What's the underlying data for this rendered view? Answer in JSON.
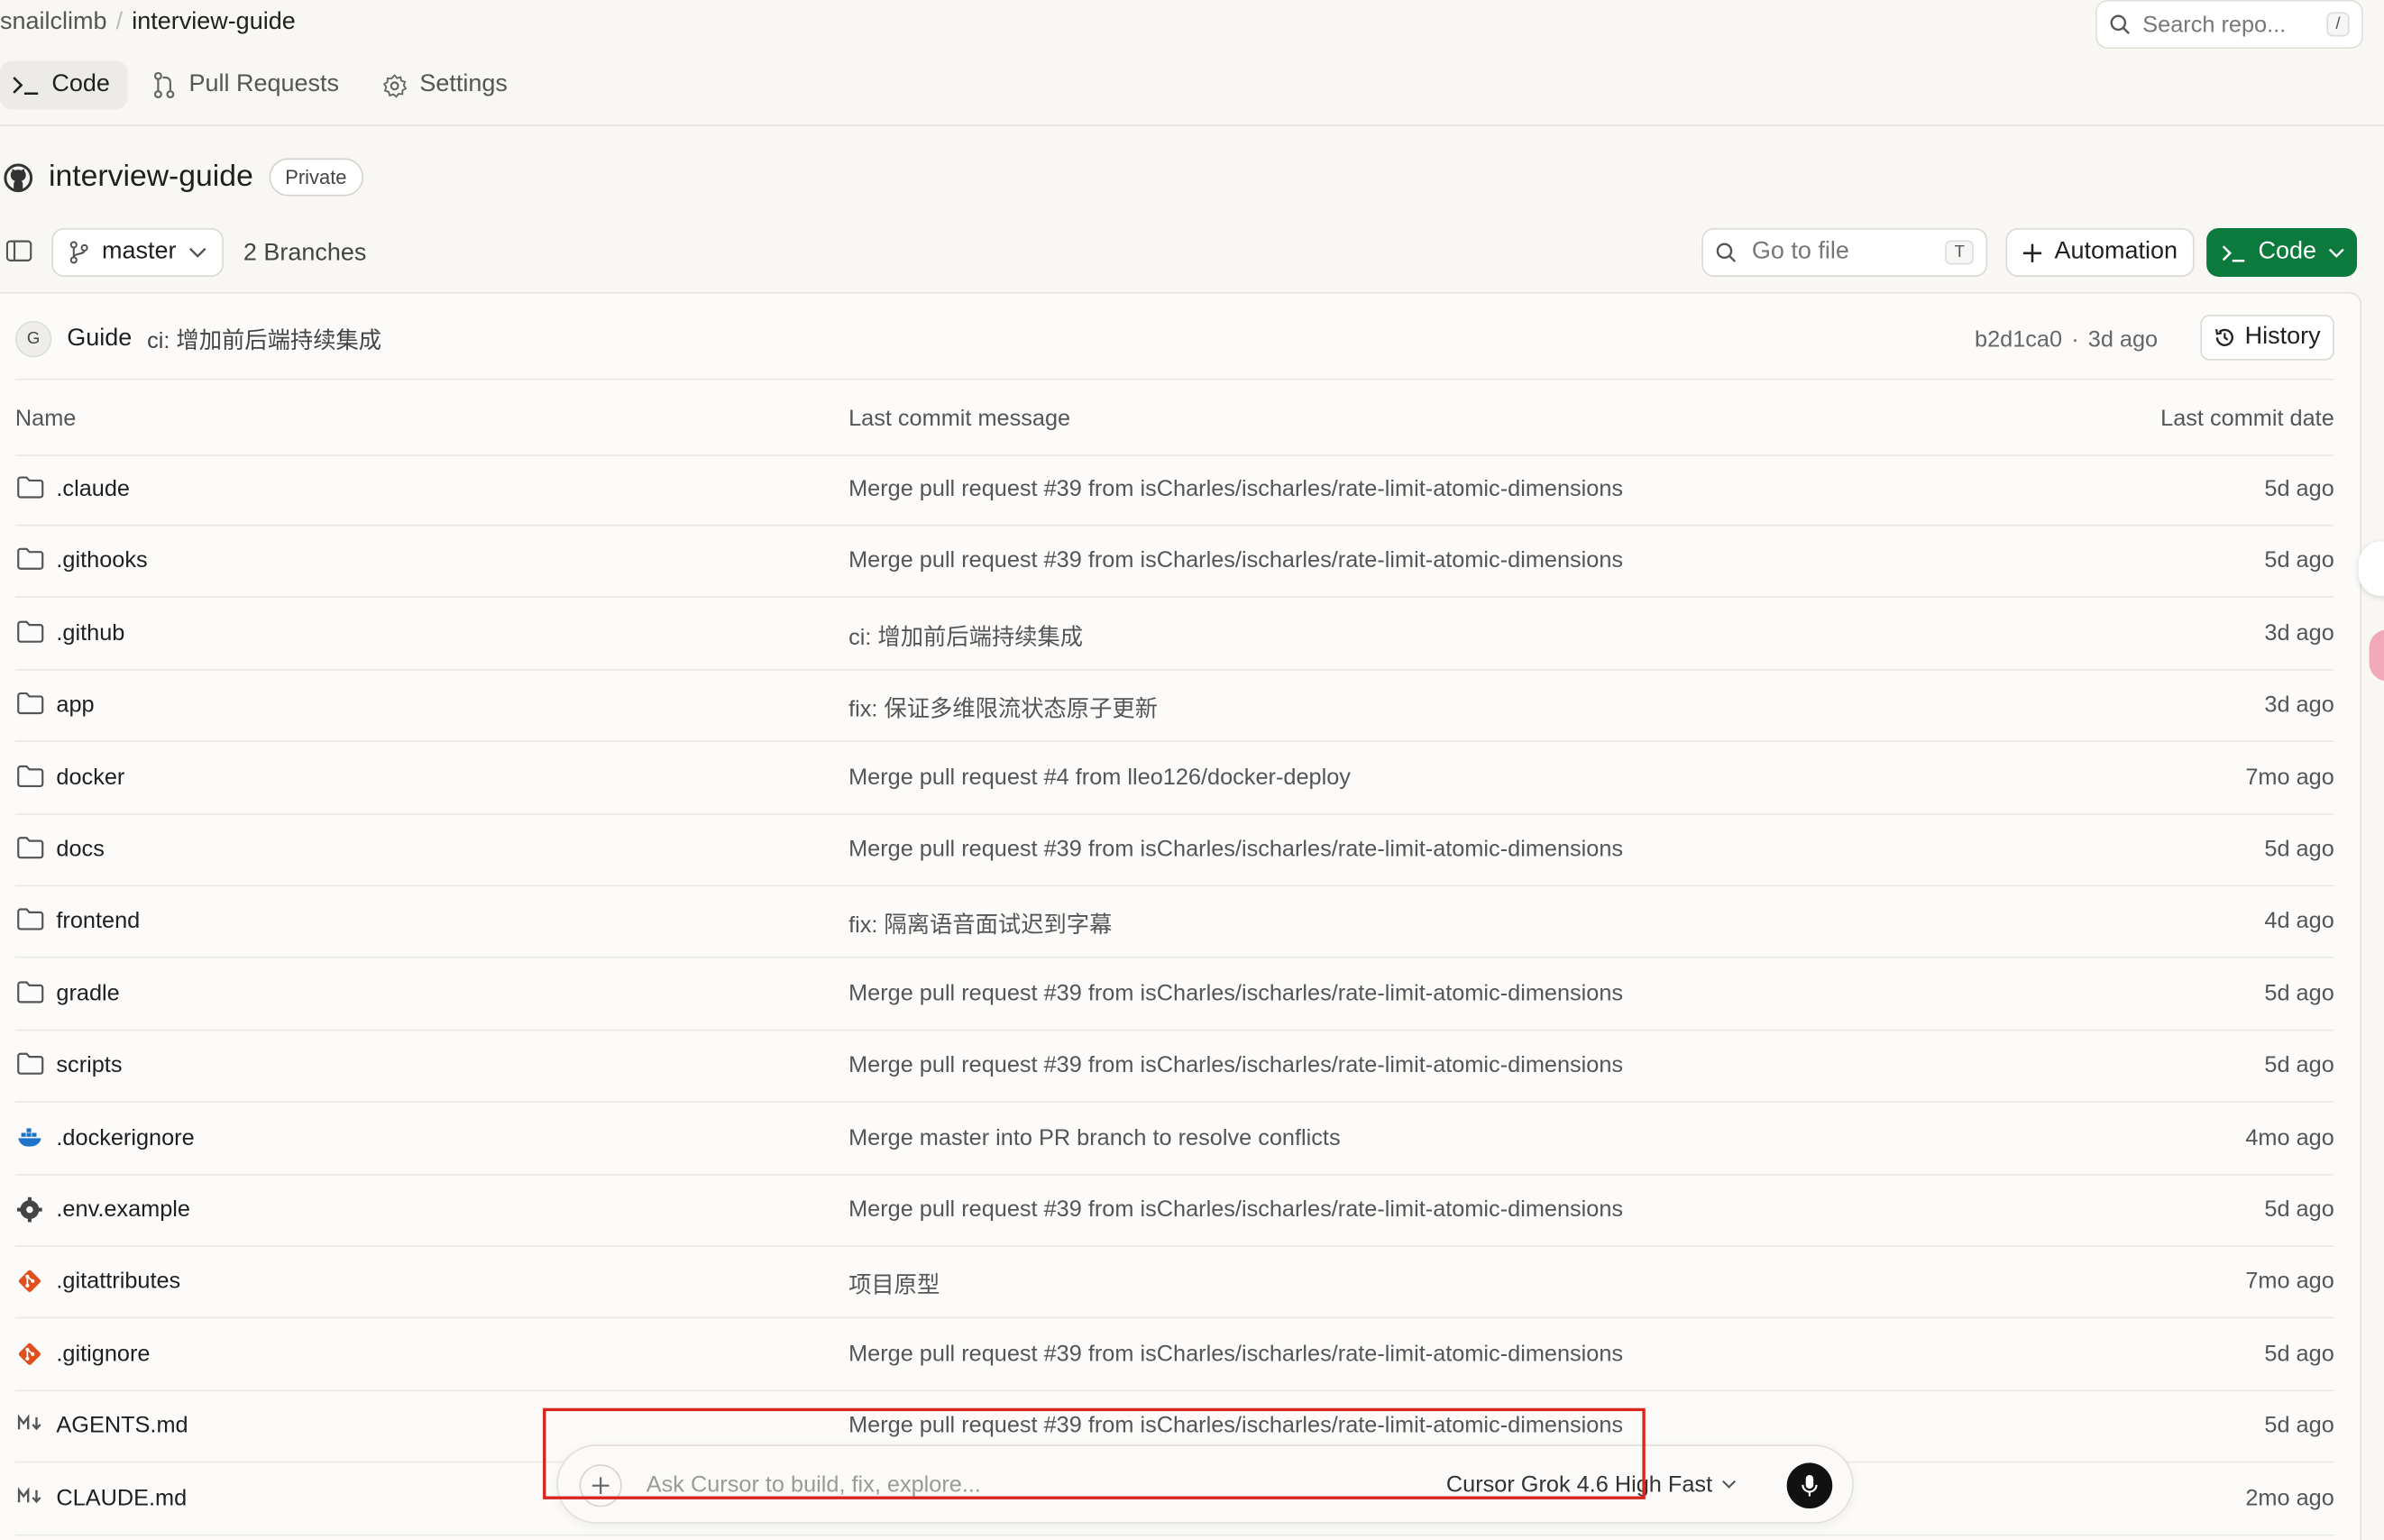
{
  "breadcrumb": {
    "owner": "snailclimb",
    "separator": "/",
    "repo": "interview-guide"
  },
  "search": {
    "placeholder": "Search repo...",
    "shortcut": "/"
  },
  "tabs": [
    {
      "label": "Code",
      "active": true,
      "icon": "terminal-icon"
    },
    {
      "label": "Pull Requests",
      "active": false,
      "icon": "pull-request-icon"
    },
    {
      "label": "Settings",
      "active": false,
      "icon": "gear-icon"
    }
  ],
  "repo": {
    "name": "interview-guide",
    "visibility": "Private"
  },
  "toolbar": {
    "branch": "master",
    "branches_count": "2 Branches",
    "goto_placeholder": "Go to file",
    "goto_shortcut": "T",
    "automation_label": "Automation",
    "code_label": "Code"
  },
  "latest_commit": {
    "avatar_letter": "G",
    "author": "Guide",
    "message": "ci: 增加前后端持续集成",
    "sha": "b2d1ca0",
    "sep": "·",
    "time": "3d ago",
    "history_label": "History"
  },
  "table": {
    "headers": {
      "name": "Name",
      "message": "Last commit message",
      "date": "Last commit date"
    },
    "rows": [
      {
        "name": ".claude",
        "type": "folder",
        "message": "Merge pull request #39 from isCharles/ischarles/rate-limit-atomic-dimensions",
        "date": "5d ago"
      },
      {
        "name": ".githooks",
        "type": "folder",
        "message": "Merge pull request #39 from isCharles/ischarles/rate-limit-atomic-dimensions",
        "date": "5d ago"
      },
      {
        "name": ".github",
        "type": "folder",
        "message": "ci: 增加前后端持续集成",
        "date": "3d ago"
      },
      {
        "name": "app",
        "type": "folder",
        "message": "fix: 保证多维限流状态原子更新",
        "date": "3d ago"
      },
      {
        "name": "docker",
        "type": "folder",
        "message": "Merge pull request #4 from lleo126/docker-deploy",
        "date": "7mo ago"
      },
      {
        "name": "docs",
        "type": "folder",
        "message": "Merge pull request #39 from isCharles/ischarles/rate-limit-atomic-dimensions",
        "date": "5d ago"
      },
      {
        "name": "frontend",
        "type": "folder",
        "message": "fix: 隔离语音面试迟到字幕",
        "date": "4d ago"
      },
      {
        "name": "gradle",
        "type": "folder",
        "message": "Merge pull request #39 from isCharles/ischarles/rate-limit-atomic-dimensions",
        "date": "5d ago"
      },
      {
        "name": "scripts",
        "type": "folder",
        "message": "Merge pull request #39 from isCharles/ischarles/rate-limit-atomic-dimensions",
        "date": "5d ago"
      },
      {
        "name": ".dockerignore",
        "type": "docker",
        "message": "Merge master into PR branch to resolve conflicts",
        "date": "4mo ago"
      },
      {
        "name": ".env.example",
        "type": "gear",
        "message": "Merge pull request #39 from isCharles/ischarles/rate-limit-atomic-dimensions",
        "date": "5d ago"
      },
      {
        "name": ".gitattributes",
        "type": "git",
        "message": "项目原型",
        "date": "7mo ago"
      },
      {
        "name": ".gitignore",
        "type": "git",
        "message": "Merge pull request #39 from isCharles/ischarles/rate-limit-atomic-dimensions",
        "date": "5d ago"
      },
      {
        "name": "AGENTS.md",
        "type": "markdown",
        "message": "Merge pull request #39 from isCharles/ischarles/rate-limit-atomic-dimensions",
        "date": "5d ago"
      },
      {
        "name": "CLAUDE.md",
        "type": "markdown",
        "message": "",
        "date": "2mo ago"
      }
    ]
  },
  "ask_bar": {
    "placeholder": "Ask Cursor to build, fix, explore...",
    "model": "Cursor Grok 4.6 High Fast"
  },
  "colors": {
    "accent_green": "#0c7a3c",
    "highlight_red": "#d9261c",
    "docker_blue": "#1d72c9",
    "git_orange": "#e0501f"
  }
}
